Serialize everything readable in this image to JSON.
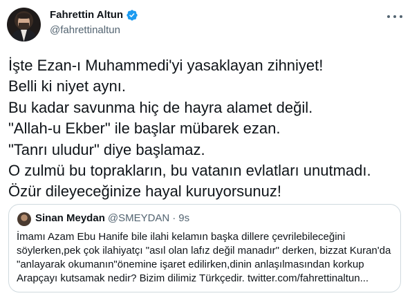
{
  "author": {
    "display_name": "Fahrettin Altun",
    "handle": "@fahrettinaltun",
    "verified": true
  },
  "tweet": {
    "lines": [
      "İşte Ezan-ı Muhammedi'yi yasaklayan zihniyet!",
      "Belli ki niyet aynı.",
      "Bu kadar savunma hiç de hayra alamet değil.",
      "\"Allah-u Ekber\" ile başlar mübarek ezan.",
      "\"Tanrı uludur\" diye başlamaz.",
      "O zulmü bu toprakların, bu vatanın evlatları unutmadı.",
      "Özür dileyeceğinize hayal kuruyorsunuz!"
    ]
  },
  "quote": {
    "display_name": "Sinan Meydan",
    "handle": "@SMEYDAN",
    "separator": "·",
    "time": "9s",
    "lines": [
      "İmamı Azam Ebu Hanife bile ilahi kelamın başka dillere çevrilebileceğini",
      "söylerken,pek çok ilahiyatçı \"asıl olan lafız değil manadır\" derken, bizzat Kuran'da",
      "\"anlayarak okumanın\"önemine işaret edilirken,dinin anlaşılmasından korkup",
      "Arapçayı kutsamak nedir? Bizim dilimiz Türkçedir. twitter.com/fahrettinaltun..."
    ]
  },
  "colors": {
    "verified_badge": "#1d9bf0",
    "secondary_text": "#536471",
    "border": "#cfd9de"
  },
  "icons": {
    "verified": "verified-badge-icon",
    "more": "more-options-icon"
  }
}
